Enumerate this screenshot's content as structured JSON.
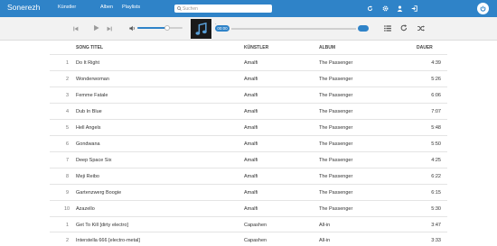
{
  "navbar": {
    "brand": "Sonerezh",
    "links": [
      "Künstler",
      "Alben",
      "Playlists"
    ],
    "search": {
      "placeholder": "Suchen",
      "value": ""
    },
    "icons": [
      "refresh-icon",
      "gear-icon",
      "user-icon",
      "sign-in-icon",
      "power-icon"
    ],
    "color": "#2f83c8"
  },
  "player": {
    "volume_fraction": 0.65,
    "current_time": "00:00",
    "total_time": "",
    "track_info": "-",
    "progress_fraction": 0,
    "icons": [
      "previous-icon",
      "play-icon",
      "next-icon",
      "volume-icon",
      "music-note-icon",
      "list-icon",
      "repeat-icon",
      "shuffle-icon"
    ]
  },
  "table": {
    "headers": {
      "title": "SONG TITEL",
      "artist": "KÜNSTLER",
      "album": "ALBUM",
      "duration": "DAUER"
    },
    "rows": [
      {
        "num": "1",
        "title": "Do It Right",
        "artist": "Amalfi",
        "album": "The Passenger",
        "duration": "4:39"
      },
      {
        "num": "2",
        "title": "Wonderwoman",
        "artist": "Amalfi",
        "album": "The Passenger",
        "duration": "5:26"
      },
      {
        "num": "3",
        "title": "Femme Fatale",
        "artist": "Amalfi",
        "album": "The Passenger",
        "duration": "6:06"
      },
      {
        "num": "4",
        "title": "Dub In Blue",
        "artist": "Amalfi",
        "album": "The Passenger",
        "duration": "7:07"
      },
      {
        "num": "5",
        "title": "Hell Angels",
        "artist": "Amalfi",
        "album": "The Passenger",
        "duration": "5:48"
      },
      {
        "num": "6",
        "title": "Gondwana",
        "artist": "Amalfi",
        "album": "The Passenger",
        "duration": "5:50"
      },
      {
        "num": "7",
        "title": "Deep Space Six",
        "artist": "Amalfi",
        "album": "The Passenger",
        "duration": "4:25"
      },
      {
        "num": "8",
        "title": "Meji Reibo",
        "artist": "Amalfi",
        "album": "The Passenger",
        "duration": "6:22"
      },
      {
        "num": "9",
        "title": "Gartenzwerg Boogie",
        "artist": "Amalfi",
        "album": "The Passenger",
        "duration": "6:15"
      },
      {
        "num": "10",
        "title": "Azazello",
        "artist": "Amalfi",
        "album": "The Passenger",
        "duration": "5:30"
      },
      {
        "num": "1",
        "title": "Get To Kill [dirty electro]",
        "artist": "Capashen",
        "album": "All-in",
        "duration": "3:47"
      },
      {
        "num": "2",
        "title": "Interstella 666 [electro-metal]",
        "artist": "Capashen",
        "album": "All-in",
        "duration": "3:33"
      }
    ]
  }
}
